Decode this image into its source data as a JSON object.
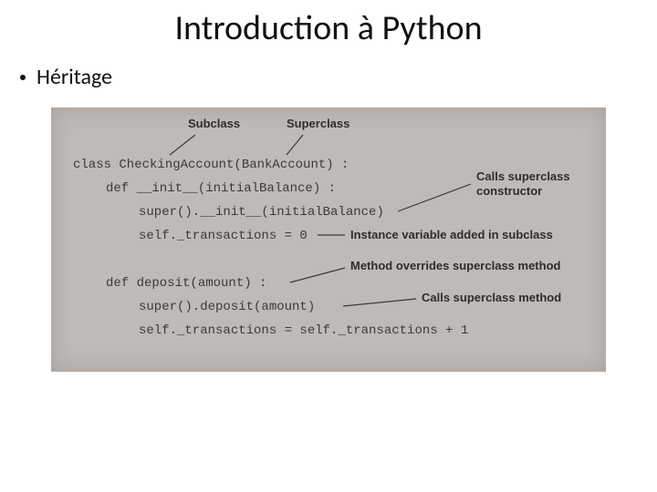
{
  "title": "Introduction à Python",
  "bullet": "Héritage",
  "labels": {
    "subclass": "Subclass",
    "superclass": "Superclass",
    "calls_super_ctor_1": "Calls superclass",
    "calls_super_ctor_2": "constructor",
    "instance_var": "Instance variable added in subclass",
    "method_override": "Method overrides superclass method",
    "calls_super_method": "Calls superclass method"
  },
  "code": {
    "l1": "class CheckingAccount(BankAccount) :",
    "l2": "def __init__(initialBalance) :",
    "l3": "super().__init__(initialBalance)",
    "l4": "self._transactions = 0",
    "l5": "def deposit(amount) :",
    "l6": "super().deposit(amount)",
    "l7": "self._transactions = self._transactions + 1"
  }
}
